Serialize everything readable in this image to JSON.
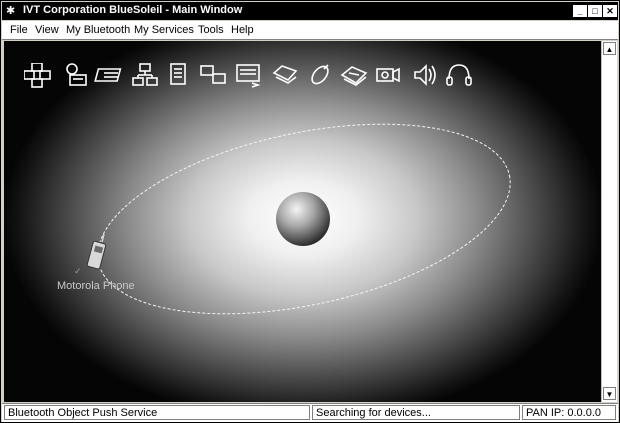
{
  "window": {
    "title": "IVT Corporation BlueSoleil - Main Window",
    "controls": [
      "minimize-icon",
      "maximize-icon",
      "close-icon"
    ]
  },
  "menu": {
    "items": [
      {
        "label": "File"
      },
      {
        "label": "View"
      },
      {
        "label": "My Bluetooth"
      },
      {
        "label": "My Services"
      },
      {
        "label": "Tools"
      },
      {
        "label": "Help"
      }
    ]
  },
  "toolbar_icons": [
    "network-access-icon",
    "dial-up-networking-icon",
    "file-transfer-icon",
    "personal-area-network-icon",
    "object-push-icon",
    "pim-sync-icon",
    "serial-port-icon",
    "fax-icon",
    "mouse-icon",
    "printer-icon",
    "av-camera-icon",
    "audio-speaker-icon",
    "headset-icon"
  ],
  "device": {
    "name": "Motorola Phone",
    "icon": "mobile-phone-icon"
  },
  "status": {
    "service": "Bluetooth Object Push Service",
    "search": "Searching for devices...",
    "pan_ip": "PAN IP: 0.0.0.0"
  }
}
